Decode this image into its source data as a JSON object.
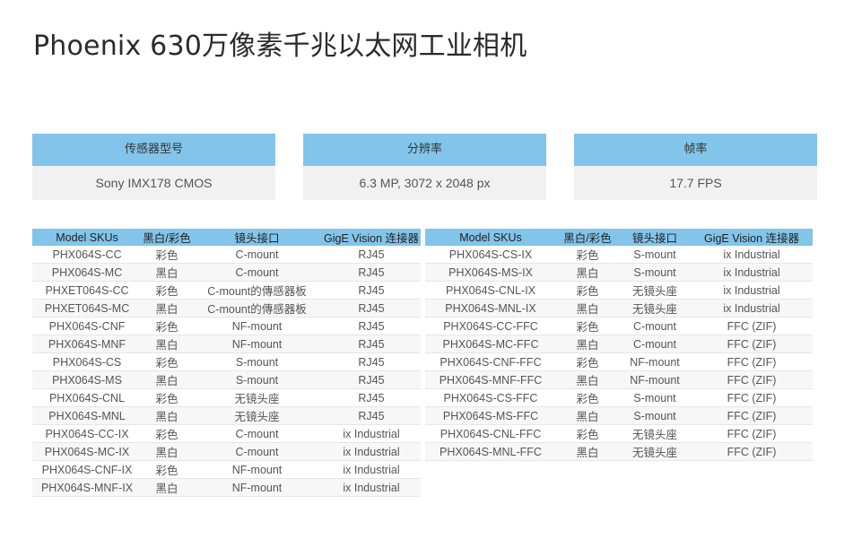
{
  "title": "Phoenix 630万像素千兆以太网工业相机",
  "specs": [
    {
      "label": "传感器型号",
      "value": "Sony IMX178 CMOS"
    },
    {
      "label": "分辨率",
      "value": "6.3 MP, 3072 x 2048 px"
    },
    {
      "label": "帧率",
      "value": "17.7 FPS"
    }
  ],
  "table_headers": [
    "Model SKUs",
    "黑白/彩色",
    "镜头接口",
    "GigE Vision 连接器"
  ],
  "left_table": [
    [
      "PHX064S-CC",
      "彩色",
      "C-mount",
      "RJ45"
    ],
    [
      "PHX064S-MC",
      "黑白",
      "C-mount",
      "RJ45"
    ],
    [
      "PHXET064S-CC",
      "彩色",
      "C-mount的傳感器板",
      "RJ45"
    ],
    [
      "PHXET064S-MC",
      "黑白",
      "C-mount的傳感器板",
      "RJ45"
    ],
    [
      "PHX064S-CNF",
      "彩色",
      "NF-mount",
      "RJ45"
    ],
    [
      "PHX064S-MNF",
      "黑白",
      "NF-mount",
      "RJ45"
    ],
    [
      "PHX064S-CS",
      "彩色",
      "S-mount",
      "RJ45"
    ],
    [
      "PHX064S-MS",
      "黑白",
      "S-mount",
      "RJ45"
    ],
    [
      "PHX064S-CNL",
      "彩色",
      "无镜头座",
      "RJ45"
    ],
    [
      "PHX064S-MNL",
      "黑白",
      "无镜头座",
      "RJ45"
    ],
    [
      "PHX064S-CC-IX",
      "彩色",
      "C-mount",
      "ix Industrial"
    ],
    [
      "PHX064S-MC-IX",
      "黑白",
      "C-mount",
      "ix Industrial"
    ],
    [
      "PHX064S-CNF-IX",
      "彩色",
      "NF-mount",
      "ix Industrial"
    ],
    [
      "PHX064S-MNF-IX",
      "黑白",
      "NF-mount",
      "ix Industrial"
    ]
  ],
  "right_table": [
    [
      "PHX064S-CS-IX",
      "彩色",
      "S-mount",
      "ix Industrial"
    ],
    [
      "PHX064S-MS-IX",
      "黑白",
      "S-mount",
      "ix Industrial"
    ],
    [
      "PHX064S-CNL-IX",
      "彩色",
      "无镜头座",
      "ix Industrial"
    ],
    [
      "PHX064S-MNL-IX",
      "黑白",
      "无镜头座",
      "ix Industrial"
    ],
    [
      "PHX064S-CC-FFC",
      "彩色",
      "C-mount",
      "FFC (ZIF)"
    ],
    [
      "PHX064S-MC-FFC",
      "黑白",
      "C-mount",
      "FFC (ZIF)"
    ],
    [
      "PHX064S-CNF-FFC",
      "彩色",
      "NF-mount",
      "FFC (ZIF)"
    ],
    [
      "PHX064S-MNF-FFC",
      "黑白",
      "NF-mount",
      "FFC (ZIF)"
    ],
    [
      "PHX064S-CS-FFC",
      "彩色",
      "S-mount",
      "FFC (ZIF)"
    ],
    [
      "PHX064S-MS-FFC",
      "黑白",
      "S-mount",
      "FFC (ZIF)"
    ],
    [
      "PHX064S-CNL-FFC",
      "彩色",
      "无镜头座",
      "FFC (ZIF)"
    ],
    [
      "PHX064S-MNL-FFC",
      "黑白",
      "无镜头座",
      "FFC (ZIF)"
    ]
  ],
  "colors": {
    "header_bg": "#82c4ea",
    "value_bg": "#f1f1f1",
    "row_alt_bg": "#f7f7f7"
  }
}
